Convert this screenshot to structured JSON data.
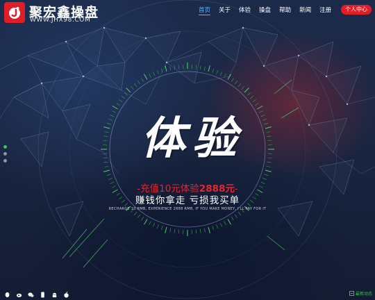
{
  "brand": {
    "name": "聚宏鑫操盘",
    "url": "WWW.JHX98.COM",
    "accent": "#e21d27"
  },
  "nav": {
    "items": [
      {
        "label": "首页",
        "active": true
      },
      {
        "label": "关于",
        "active": false
      },
      {
        "label": "体验",
        "active": false
      },
      {
        "label": "操盘",
        "active": false
      },
      {
        "label": "帮助",
        "active": false
      },
      {
        "label": "新闻",
        "active": false
      },
      {
        "label": "注册",
        "active": false
      }
    ],
    "user_center": "个人中心",
    "active_color": "#56b7ff"
  },
  "slider": {
    "dots": 3,
    "active_dot": 0
  },
  "hero": {
    "title": "体验",
    "promo_prefix": "-充值10元体验",
    "promo_amount": "2888元",
    "promo_suffix": "-",
    "slogan": "赚钱你拿走 亏损我买单",
    "slogan_en": "RECHARGE 10 RMB, EXPERIENCE 2888 RMB, IF YOU MAKE MONEY, I'LL PAY FOR IT"
  },
  "footer": {
    "live_label": "最新动态",
    "icons": [
      "qq-icon",
      "weibo-icon",
      "wechat-icon",
      "phone-icon",
      "android-icon",
      "apple-icon"
    ]
  }
}
